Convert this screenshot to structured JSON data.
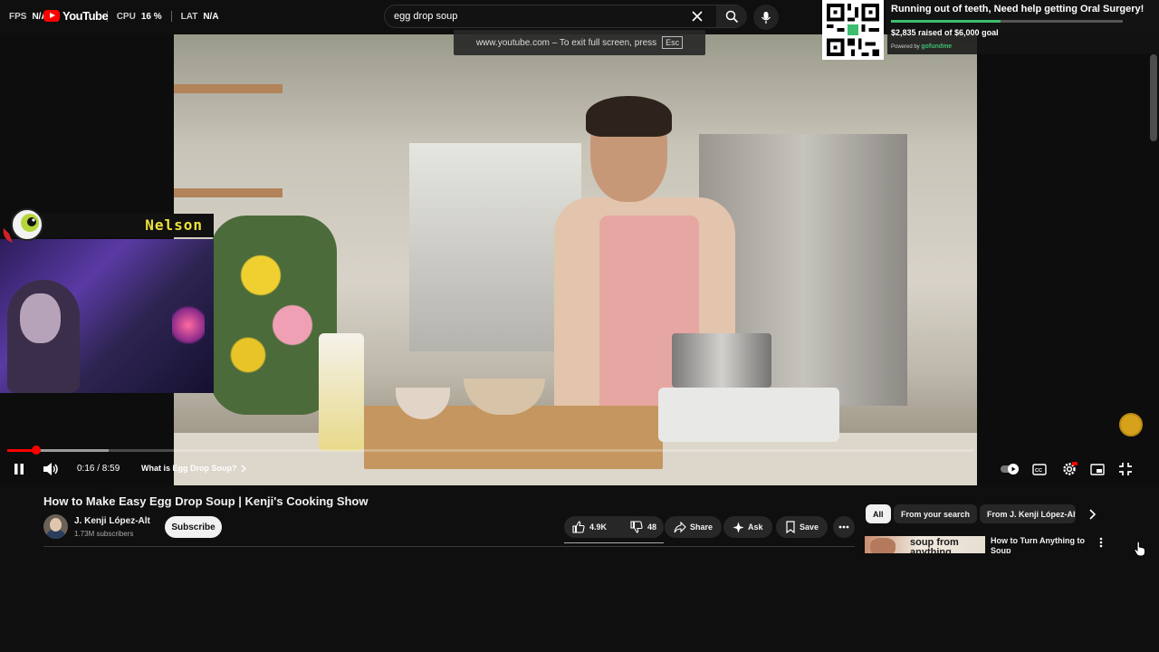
{
  "stats": {
    "fps_label": "FPS",
    "fps_value": "N/A",
    "cpu_label": "CPU",
    "cpu_value": "16 %",
    "lat_label": "LAT",
    "lat_value": "N/A"
  },
  "logo": {
    "text": "YouTube"
  },
  "search": {
    "query": "egg drop soup"
  },
  "fullscreen_notice": {
    "text": "www.youtube.com – To exit full screen, press",
    "key": "Esc"
  },
  "gofundme": {
    "title": "Running out of teeth, Need help getting Oral Surgery!",
    "raised_text": "$2,835 raised of $6,000 goal",
    "progress_fraction": 0.4725,
    "powered_by": "Powered by",
    "brand": "gofundme",
    "brand_color": "#3ebd70"
  },
  "webcam": {
    "name": "Nelson",
    "name_color": "#ece23a"
  },
  "player": {
    "time": "0:16 / 8:59",
    "played_fraction": 0.0297,
    "loaded_fraction": 0.105,
    "chapter": "What is Egg Drop Soup?",
    "accent": "#ff0000"
  },
  "video": {
    "title": "How to Make Easy Egg Drop Soup | Kenji's Cooking Show",
    "channel": "J. Kenji López-Alt",
    "subscribers": "1.73M subscribers",
    "subscribe_label": "Subscribe",
    "likes": "4.9K",
    "dislikes": "48",
    "share_label": "Share",
    "ask_label": "Ask",
    "save_label": "Save"
  },
  "chips": [
    {
      "label": "All",
      "active": true
    },
    {
      "label": "From your search",
      "active": false
    },
    {
      "label": "From J. Kenji López-Alt",
      "active": false
    }
  ],
  "related": [
    {
      "thumb_text": "soup from anything",
      "title": "How to Turn Anything to Soup"
    }
  ]
}
